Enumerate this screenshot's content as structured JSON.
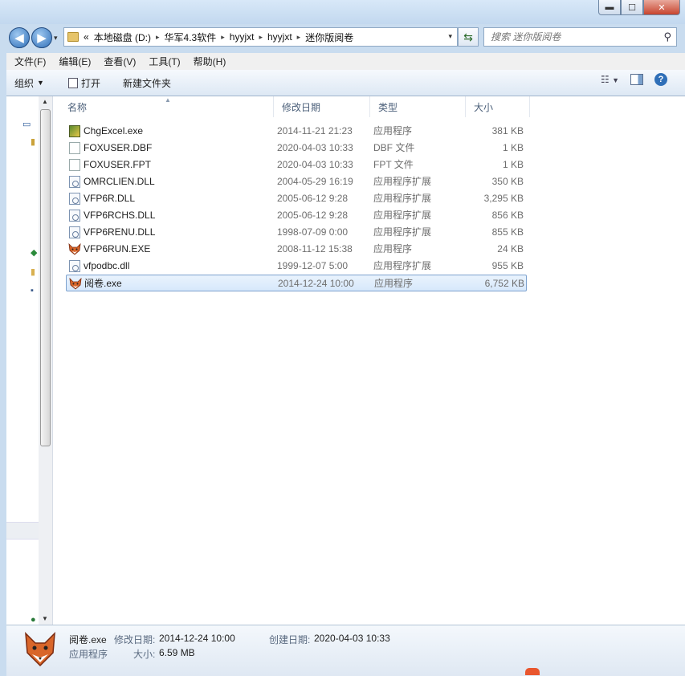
{
  "window": {
    "minimize": "▬",
    "maximize": "☐",
    "close": "✕"
  },
  "nav": {
    "back": "◀",
    "forward": "▶",
    "recent": "▾"
  },
  "address": {
    "overflow": "«",
    "crumbs": [
      "本地磁盘 (D:)",
      "华军4.3软件",
      "hyyjxt",
      "hyyjxt",
      "迷你版阅卷"
    ],
    "separator": "▸",
    "dropdown": "▾"
  },
  "search": {
    "placeholder": "搜索 迷你版阅卷"
  },
  "menu": [
    "文件(F)",
    "编辑(E)",
    "查看(V)",
    "工具(T)",
    "帮助(H)"
  ],
  "toolbar": {
    "organize": "组织",
    "open": "打开",
    "new_folder": "新建文件夹"
  },
  "columns": {
    "name": "名称",
    "date": "修改日期",
    "type": "类型",
    "size": "大小"
  },
  "files": [
    {
      "name": "ChgExcel.exe",
      "date": "2014-11-21 21:23",
      "type": "应用程序",
      "size": "381 KB",
      "icon": "excel-exe-icon"
    },
    {
      "name": "FOXUSER.DBF",
      "date": "2020-04-03 10:33",
      "type": "DBF 文件",
      "size": "1 KB",
      "icon": "blank-file-icon"
    },
    {
      "name": "FOXUSER.FPT",
      "date": "2020-04-03 10:33",
      "type": "FPT 文件",
      "size": "1 KB",
      "icon": "blank-file-icon"
    },
    {
      "name": "OMRCLIEN.DLL",
      "date": "2004-05-29 16:19",
      "type": "应用程序扩展",
      "size": "350 KB",
      "icon": "dll-icon"
    },
    {
      "name": "VFP6R.DLL",
      "date": "2005-06-12 9:28",
      "type": "应用程序扩展",
      "size": "3,295 KB",
      "icon": "dll-icon"
    },
    {
      "name": "VFP6RCHS.DLL",
      "date": "2005-06-12 9:28",
      "type": "应用程序扩展",
      "size": "856 KB",
      "icon": "dll-icon"
    },
    {
      "name": "VFP6RENU.DLL",
      "date": "1998-07-09 0:00",
      "type": "应用程序扩展",
      "size": "855 KB",
      "icon": "dll-icon"
    },
    {
      "name": "VFP6RUN.EXE",
      "date": "2008-11-12 15:38",
      "type": "应用程序",
      "size": "24 KB",
      "icon": "fox-icon"
    },
    {
      "name": "vfpodbc.dll",
      "date": "1999-12-07 5:00",
      "type": "应用程序扩展",
      "size": "955 KB",
      "icon": "dll-icon"
    },
    {
      "name": "阅卷.exe",
      "date": "2014-12-24 10:00",
      "type": "应用程序",
      "size": "6,752 KB",
      "icon": "fox-icon",
      "selected": true
    }
  ],
  "status": {
    "name": "阅卷.exe",
    "modified_label": "修改日期:",
    "modified": "2014-12-24 10:00",
    "created_label": "创建日期:",
    "created": "2020-04-03 10:33",
    "type": "应用程序",
    "size_label": "大小:",
    "size": "6.59 MB"
  }
}
